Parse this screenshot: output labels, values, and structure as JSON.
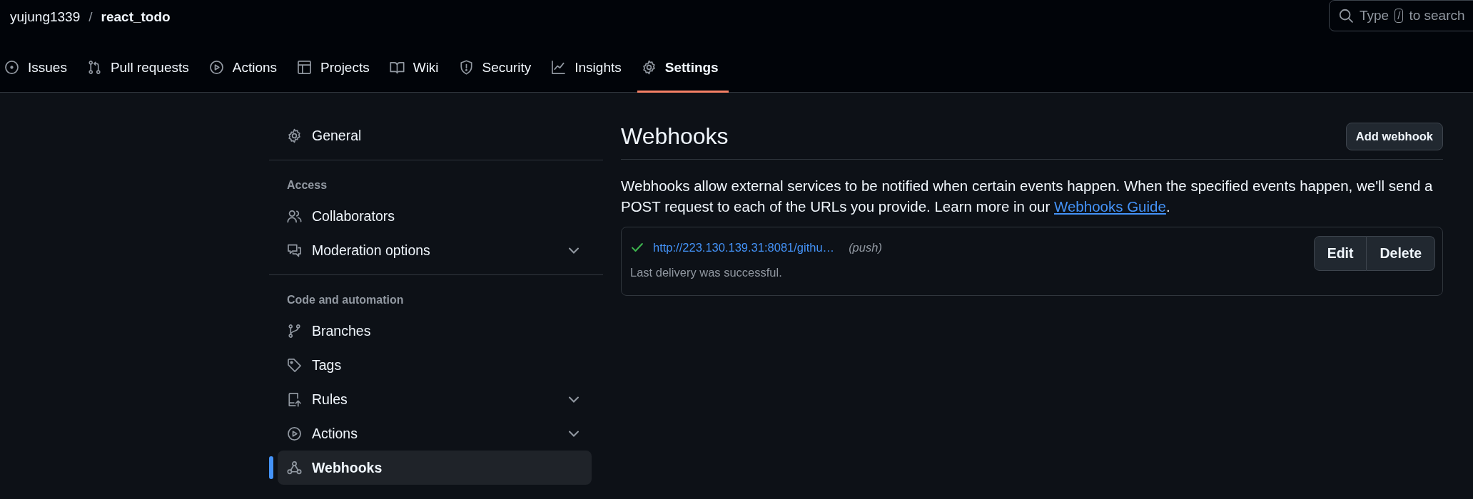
{
  "breadcrumb": {
    "owner": "yujung1339",
    "separator": "/",
    "repo": "react_todo"
  },
  "search": {
    "hint": "Type",
    "key": "/",
    "hint_end": "to search"
  },
  "tabs": [
    {
      "label": "Issues",
      "selected": false
    },
    {
      "label": "Pull requests",
      "selected": false
    },
    {
      "label": "Actions",
      "selected": false
    },
    {
      "label": "Projects",
      "selected": false
    },
    {
      "label": "Wiki",
      "selected": false
    },
    {
      "label": "Security",
      "selected": false
    },
    {
      "label": "Insights",
      "selected": false
    },
    {
      "label": "Settings",
      "selected": true
    }
  ],
  "sidebar": {
    "sections": [
      {
        "items": [
          {
            "label": "General",
            "selected": false,
            "kind": "link"
          }
        ]
      },
      {
        "heading": "Access",
        "items": [
          {
            "label": "Collaborators",
            "selected": false,
            "kind": "link"
          },
          {
            "label": "Moderation options",
            "selected": false,
            "kind": "group",
            "expanded": false
          }
        ]
      },
      {
        "heading": "Code and automation",
        "items": [
          {
            "label": "Branches",
            "selected": false,
            "kind": "link"
          },
          {
            "label": "Tags",
            "selected": false,
            "kind": "link"
          },
          {
            "label": "Rules",
            "selected": false,
            "kind": "group",
            "expanded": false
          },
          {
            "label": "Actions",
            "selected": false,
            "kind": "group",
            "expanded": false
          },
          {
            "label": "Webhooks",
            "selected": true,
            "kind": "link"
          }
        ]
      }
    ]
  },
  "main": {
    "title": "Webhooks",
    "add_button": "Add webhook",
    "description": "Webhooks allow external services to be notified when certain events happen. When the specified events happen, we'll send a POST request to each of the URLs you provide. Learn more in our ",
    "guide_link": "Webhooks Guide",
    "description_end": ".",
    "webhooks": [
      {
        "url": "http://223.130.139.31:8081/githu…",
        "events": "(push)",
        "delivery_ok": true,
        "status": "Last delivery was successful.",
        "edit": "Edit",
        "delete": "Delete"
      }
    ]
  }
}
